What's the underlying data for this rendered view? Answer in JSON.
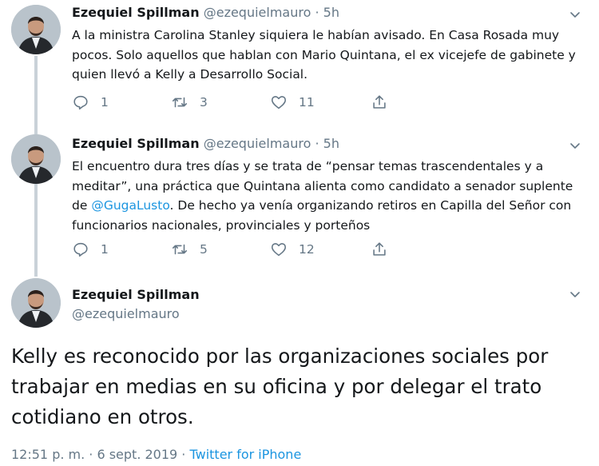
{
  "tweets": [
    {
      "name": "Ezequiel Spillman",
      "handle": "@ezequielmauro",
      "separator": "·",
      "time": "5h",
      "text": "A la ministra Carolina Stanley siquiera le habían avisado. En Casa Rosada muy pocos. Solo aquellos que hablan con Mario Quintana, el ex vicejefe de gabinete y quien llevó a Kelly a Desarrollo Social.",
      "replies": "1",
      "retweets": "3",
      "likes": "11"
    },
    {
      "name": "Ezequiel Spillman",
      "handle": "@ezequielmauro",
      "separator": "·",
      "time": "5h",
      "text_before": "El encuentro dura tres días y se trata de “pensar temas trascendentales y a meditar”, una práctica que Quintana alienta como candidato a senador suplente de ",
      "mention": "@GugaLusto",
      "text_after": ". De hecho ya venía organizando retiros en Capilla del Señor con funcionarios nacionales, provinciales y porteños",
      "replies": "1",
      "retweets": "5",
      "likes": "12"
    }
  ],
  "main": {
    "name": "Ezequiel Spillman",
    "handle": "@ezequielmauro",
    "text": "Kelly es reconocido por las organizaciones sociales por trabajar en medias en su oficina y por delegar el trato cotidiano en otros.",
    "timestamp": "12:51 p. m. · 6 sept. 2019 · ",
    "source": "Twitter for iPhone"
  },
  "icons": {
    "reply": "reply-icon",
    "retweet": "retweet-icon",
    "like": "heart-icon",
    "share": "share-icon",
    "chevron": "chevron-down-icon"
  },
  "colors": {
    "link": "#1b95e0",
    "secondary": "#657786",
    "thread_line": "#c9d1d8"
  }
}
